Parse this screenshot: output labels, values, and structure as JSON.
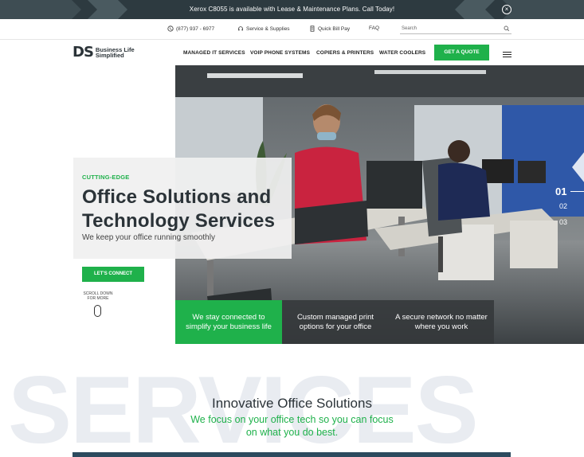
{
  "announcement": {
    "text": "Xerox C8055 is available with Lease & Maintenance Plans. Call Today!",
    "close_icon": "close-circle-icon"
  },
  "utility_bar": {
    "phone": "(877) 937 - 6977",
    "service": "Service & Supplies",
    "bill_pay": "Quick Bill Pay",
    "faq": "FAQ",
    "search_placeholder": "Search"
  },
  "nav": {
    "logo_mark": "DS",
    "logo_line1": "Business Life",
    "logo_line2": "Simplified",
    "links": [
      "MANAGED IT SERVICES",
      "VOIP PHONE SYSTEMS",
      "COPIERS & PRINTERS",
      "WATER COOLERS"
    ],
    "cta": "GET A QUOTE"
  },
  "hero": {
    "eyebrow": "CUTTING-EDGE",
    "title_line1": "Office Solutions and",
    "title_line2": "Technology Services",
    "subtitle": "We keep your office running smoothly",
    "cta": "LET'S CONNECT",
    "scroll_line1": "SCROLL DOWN",
    "scroll_line2": "FOR MORE",
    "slides": [
      "01",
      "02",
      "03"
    ],
    "tiles": [
      "We stay connected to simplify your business life",
      "Custom managed print options for your office",
      "A secure network no matter where you work"
    ]
  },
  "services": {
    "background_word": "SERVICES",
    "title": "Innovative Office Solutions",
    "subtitle_line1": "We focus on your office tech so you can focus",
    "subtitle_line2": "on what you do best."
  },
  "colors": {
    "brand_green": "#1fb14b",
    "dark": "#2b3338",
    "announce_bg": "#2d3a40"
  }
}
